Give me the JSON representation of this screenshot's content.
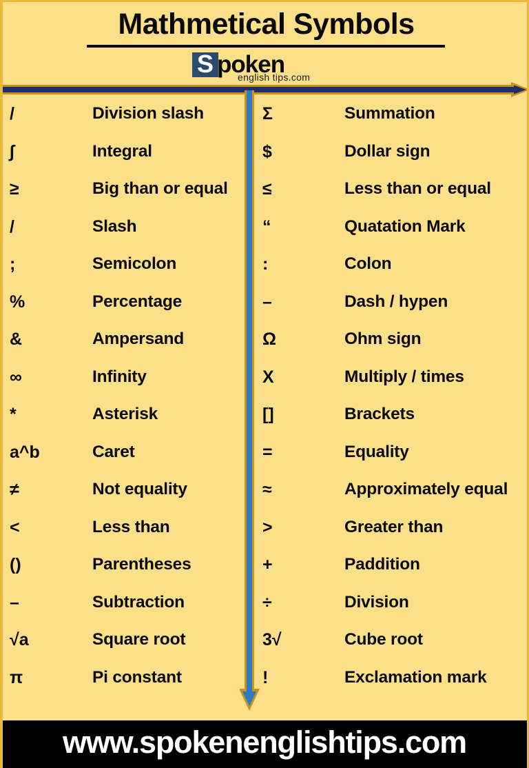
{
  "header": {
    "title": "Mathmetical Symbols",
    "logo": {
      "badge_letter": "S",
      "word": "poken",
      "tagline": "english tips.com"
    }
  },
  "colors": {
    "background": "#FBE089",
    "border": "#E8B93A",
    "arrow_navy": "#1F2E6B",
    "arrow_blue": "#2E7BC4",
    "arrow_gold": "#C9911E",
    "text": "#0A0A0A",
    "footer_bg": "#000000",
    "footer_text": "#FFFFFF",
    "logo_badge_bg": "#2C4A6B"
  },
  "columns": {
    "left": [
      {
        "symbol": "/",
        "label": "Division slash"
      },
      {
        "symbol": "∫",
        "label": "Integral"
      },
      {
        "symbol": "≥",
        "label": "Big than or equal"
      },
      {
        "symbol": "/",
        "label": "Slash"
      },
      {
        "symbol": ";",
        "label": "Semicolon"
      },
      {
        "symbol": "%",
        "label": "Percentage"
      },
      {
        "symbol": "&",
        "label": "Ampersand"
      },
      {
        "symbol": "∞",
        "label": "Infinity"
      },
      {
        "symbol": "*",
        "label": "Asterisk"
      },
      {
        "symbol": "a^b",
        "label": "Caret"
      },
      {
        "symbol": "≠",
        "label": "Not equality"
      },
      {
        "symbol": "<",
        "label": "Less than"
      },
      {
        "symbol": "()",
        "label": "Parentheses"
      },
      {
        "symbol": "–",
        "label": "Subtraction"
      },
      {
        "symbol": "√a",
        "label": "Square root"
      },
      {
        "symbol": "π",
        "label": "Pi constant"
      }
    ],
    "right": [
      {
        "symbol": "Σ",
        "label": "Summation"
      },
      {
        "symbol": "$",
        "label": "Dollar sign"
      },
      {
        "symbol": "≤",
        "label": "Less than or equal"
      },
      {
        "symbol": "“",
        "label": "Quatation Mark"
      },
      {
        "symbol": ":",
        "label": "Colon"
      },
      {
        "symbol": "–",
        "label": "Dash / hypen"
      },
      {
        "symbol": "Ω",
        "label": "Ohm sign"
      },
      {
        "symbol": "X",
        "label": "Multiply / times"
      },
      {
        "symbol": "[]",
        "label": "Brackets"
      },
      {
        "symbol": "=",
        "label": "Equality"
      },
      {
        "symbol": "≈",
        "label": "Approximately equal"
      },
      {
        "symbol": ">",
        "label": "Greater than"
      },
      {
        "symbol": "+",
        "label": "Paddition"
      },
      {
        "symbol": "÷",
        "label": "Division"
      },
      {
        "symbol": "3√",
        "label": "Cube root"
      },
      {
        "symbol": "!",
        "label": "Exclamation mark"
      }
    ]
  },
  "footer": {
    "url": "www.spokenenglishtips.com"
  },
  "icons": {
    "horizontal_arrow": "arrow-right-icon",
    "vertical_arrow": "arrow-down-icon"
  }
}
